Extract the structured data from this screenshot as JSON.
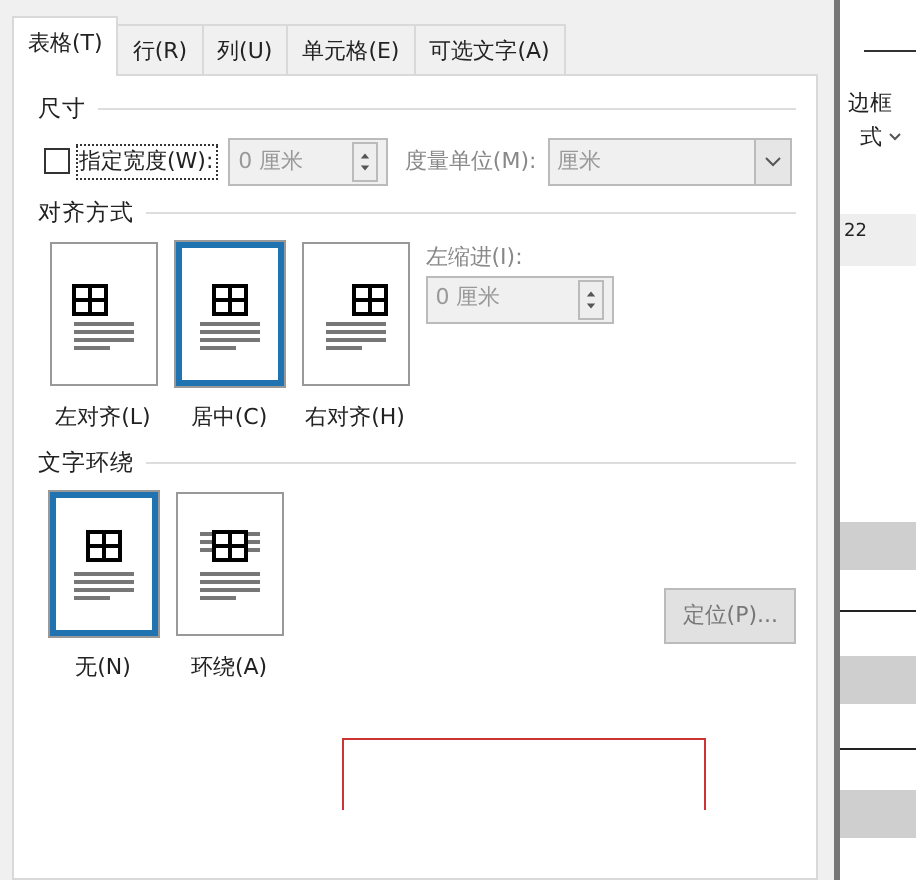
{
  "tabs": [
    {
      "label": "表格(T)",
      "selected": true
    },
    {
      "label": "行(R)",
      "selected": false
    },
    {
      "label": "列(U)",
      "selected": false
    },
    {
      "label": "单元格(E)",
      "selected": false
    },
    {
      "label": "可选文字(A)",
      "selected": false
    }
  ],
  "size": {
    "title": "尺寸",
    "preferred_width": {
      "label": "指定宽度(W):",
      "checked": false
    },
    "width_field": {
      "value": "0 厘米",
      "disabled": true
    },
    "unit_label": "度量单位(M):",
    "unit_field": {
      "value": "厘米",
      "disabled": true
    }
  },
  "alignment": {
    "title": "对齐方式",
    "options": [
      {
        "label": "左对齐(L)",
        "kind": "left",
        "selected": false
      },
      {
        "label": "居中(C)",
        "kind": "center",
        "selected": true
      },
      {
        "label": "右对齐(H)",
        "kind": "right",
        "selected": false
      }
    ],
    "indent_label": "左缩进(I):",
    "indent_field": {
      "value": "0 厘米",
      "disabled": true
    }
  },
  "text_wrapping": {
    "title": "文字环绕",
    "options": [
      {
        "label": "无(N)",
        "kind": "none",
        "selected": true
      },
      {
        "label": "环绕(A)",
        "kind": "around",
        "selected": false
      }
    ],
    "positioning_button": {
      "label": "定位(P)...",
      "disabled": true
    }
  },
  "background": {
    "ribbon_label_1": "边框",
    "ribbon_label_2": "式",
    "ruler_number": "22"
  }
}
